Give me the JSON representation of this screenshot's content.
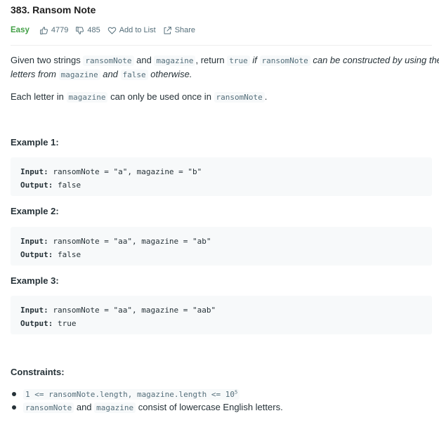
{
  "problem": {
    "title": "383. Ransom Note",
    "difficulty": "Easy",
    "likes": "4779",
    "dislikes": "485",
    "add_to_list": "Add to List",
    "share": "Share"
  },
  "description": {
    "line1_a": "Given two strings ",
    "code_ransom": "ransomNote",
    "and": " and ",
    "code_magazine": "magazine",
    "line1_b": ", return ",
    "code_true": "true",
    "line1_c": " if ",
    "line1_d": " can be constructed by using the",
    "line2_a": "letters from ",
    "line2_b": " and ",
    "code_false": "false",
    "line2_c": " otherwise.",
    "line3_a": "Each letter in ",
    "line3_b": " can only be used once in ",
    "line3_c": "."
  },
  "examples": [
    {
      "heading": "Example 1:",
      "input_label": "Input:",
      "input": " ransomNote = \"a\", magazine = \"b\"",
      "output_label": "Output:",
      "output": " false"
    },
    {
      "heading": "Example 2:",
      "input_label": "Input:",
      "input": " ransomNote = \"aa\", magazine = \"ab\"",
      "output_label": "Output:",
      "output": " false"
    },
    {
      "heading": "Example 3:",
      "input_label": "Input:",
      "input": " ransomNote = \"aa\", magazine = \"aab\"",
      "output_label": "Output:",
      "output": " true"
    }
  ],
  "constraints": {
    "heading": "Constraints:",
    "c1_code": "1 <= ransomNote.length, magazine.length <= 10",
    "c1_sup": "5",
    "c2_code_a": "ransomNote",
    "c2_and": " and ",
    "c2_code_b": "magazine",
    "c2_rest": " consist of lowercase English letters."
  },
  "colors": {
    "easy": "#43a047",
    "text": "#263238",
    "muted": "#546e7a",
    "code_bg": "#f7f9fa"
  }
}
